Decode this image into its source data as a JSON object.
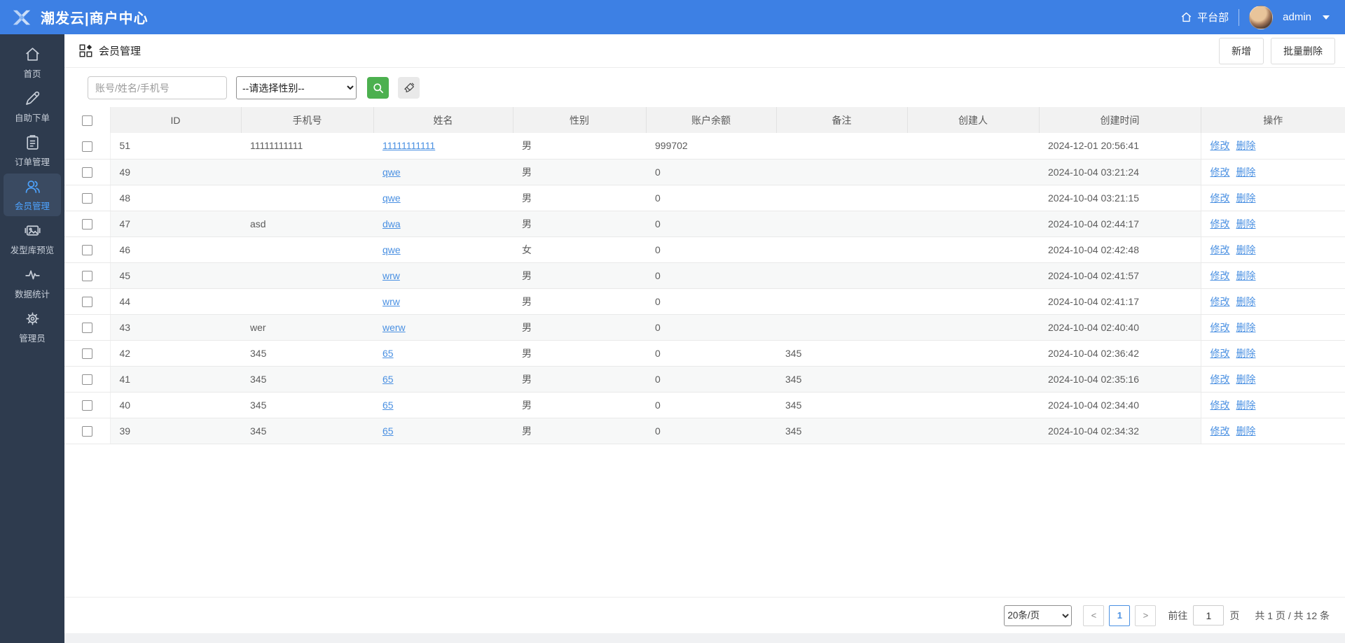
{
  "colors": {
    "topbar": "#3d80e4",
    "sidebar": "#2e3b4e",
    "active": "#4da3ff",
    "link": "#4a90e2",
    "green": "#4cb04f"
  },
  "topbar": {
    "brand": "潮发云|商户中心",
    "dept": "平台部",
    "user": "admin"
  },
  "sidebar": {
    "items": [
      {
        "key": "home",
        "icon": "home-icon",
        "label": "首页",
        "active": false
      },
      {
        "key": "order",
        "icon": "pencil-icon",
        "label": "自助下单",
        "active": false
      },
      {
        "key": "orders",
        "icon": "clipboard-icon",
        "label": "订单管理",
        "active": false
      },
      {
        "key": "members",
        "icon": "users-icon",
        "label": "会员管理",
        "active": true
      },
      {
        "key": "gallery",
        "icon": "gallery-icon",
        "label": "发型库预览",
        "active": false
      },
      {
        "key": "stats",
        "icon": "pulse-icon",
        "label": "数据统计",
        "active": false
      },
      {
        "key": "admin",
        "icon": "gear-icon",
        "label": "管理员",
        "active": false
      }
    ]
  },
  "page": {
    "title": "会员管理",
    "add_label": "新增",
    "batch_delete_label": "批量删除"
  },
  "search": {
    "keyword_placeholder": "账号/姓名/手机号",
    "gender_option": "--请选择性别--"
  },
  "table": {
    "columns": [
      "ID",
      "手机号",
      "姓名",
      "性别",
      "账户余额",
      "备注",
      "创建人",
      "创建时间",
      "操作"
    ],
    "actions": {
      "edit": "修改",
      "delete": "删除"
    },
    "rows": [
      {
        "id": "51",
        "phone": "11111111111",
        "name": "11111111111",
        "gender": "男",
        "balance": "999702",
        "remark": "",
        "creator": "",
        "created": "2024-12-01 20:56:41"
      },
      {
        "id": "49",
        "phone": "",
        "name": "qwe",
        "gender": "男",
        "balance": "0",
        "remark": "",
        "creator": "",
        "created": "2024-10-04 03:21:24"
      },
      {
        "id": "48",
        "phone": "",
        "name": "qwe",
        "gender": "男",
        "balance": "0",
        "remark": "",
        "creator": "",
        "created": "2024-10-04 03:21:15"
      },
      {
        "id": "47",
        "phone": "asd",
        "name": "dwa",
        "gender": "男",
        "balance": "0",
        "remark": "",
        "creator": "",
        "created": "2024-10-04 02:44:17"
      },
      {
        "id": "46",
        "phone": "",
        "name": "qwe",
        "gender": "女",
        "balance": "0",
        "remark": "",
        "creator": "",
        "created": "2024-10-04 02:42:48"
      },
      {
        "id": "45",
        "phone": "",
        "name": "wrw",
        "gender": "男",
        "balance": "0",
        "remark": "",
        "creator": "",
        "created": "2024-10-04 02:41:57"
      },
      {
        "id": "44",
        "phone": "",
        "name": "wrw",
        "gender": "男",
        "balance": "0",
        "remark": "",
        "creator": "",
        "created": "2024-10-04 02:41:17"
      },
      {
        "id": "43",
        "phone": "wer",
        "name": "werw",
        "gender": "男",
        "balance": "0",
        "remark": "",
        "creator": "",
        "created": "2024-10-04 02:40:40"
      },
      {
        "id": "42",
        "phone": "345",
        "name": "65",
        "gender": "男",
        "balance": "0",
        "remark": "345",
        "creator": "",
        "created": "2024-10-04 02:36:42"
      },
      {
        "id": "41",
        "phone": "345",
        "name": "65",
        "gender": "男",
        "balance": "0",
        "remark": "345",
        "creator": "",
        "created": "2024-10-04 02:35:16"
      },
      {
        "id": "40",
        "phone": "345",
        "name": "65",
        "gender": "男",
        "balance": "0",
        "remark": "345",
        "creator": "",
        "created": "2024-10-04 02:34:40"
      },
      {
        "id": "39",
        "phone": "345",
        "name": "65",
        "gender": "男",
        "balance": "0",
        "remark": "345",
        "creator": "",
        "created": "2024-10-04 02:34:32"
      }
    ]
  },
  "pagination": {
    "page_size": "20条/页",
    "prev": "<",
    "current": "1",
    "next": ">",
    "goto_label": "前往",
    "goto_value": "1",
    "page_unit": "页",
    "total": "共 1 页 / 共 12 条"
  }
}
